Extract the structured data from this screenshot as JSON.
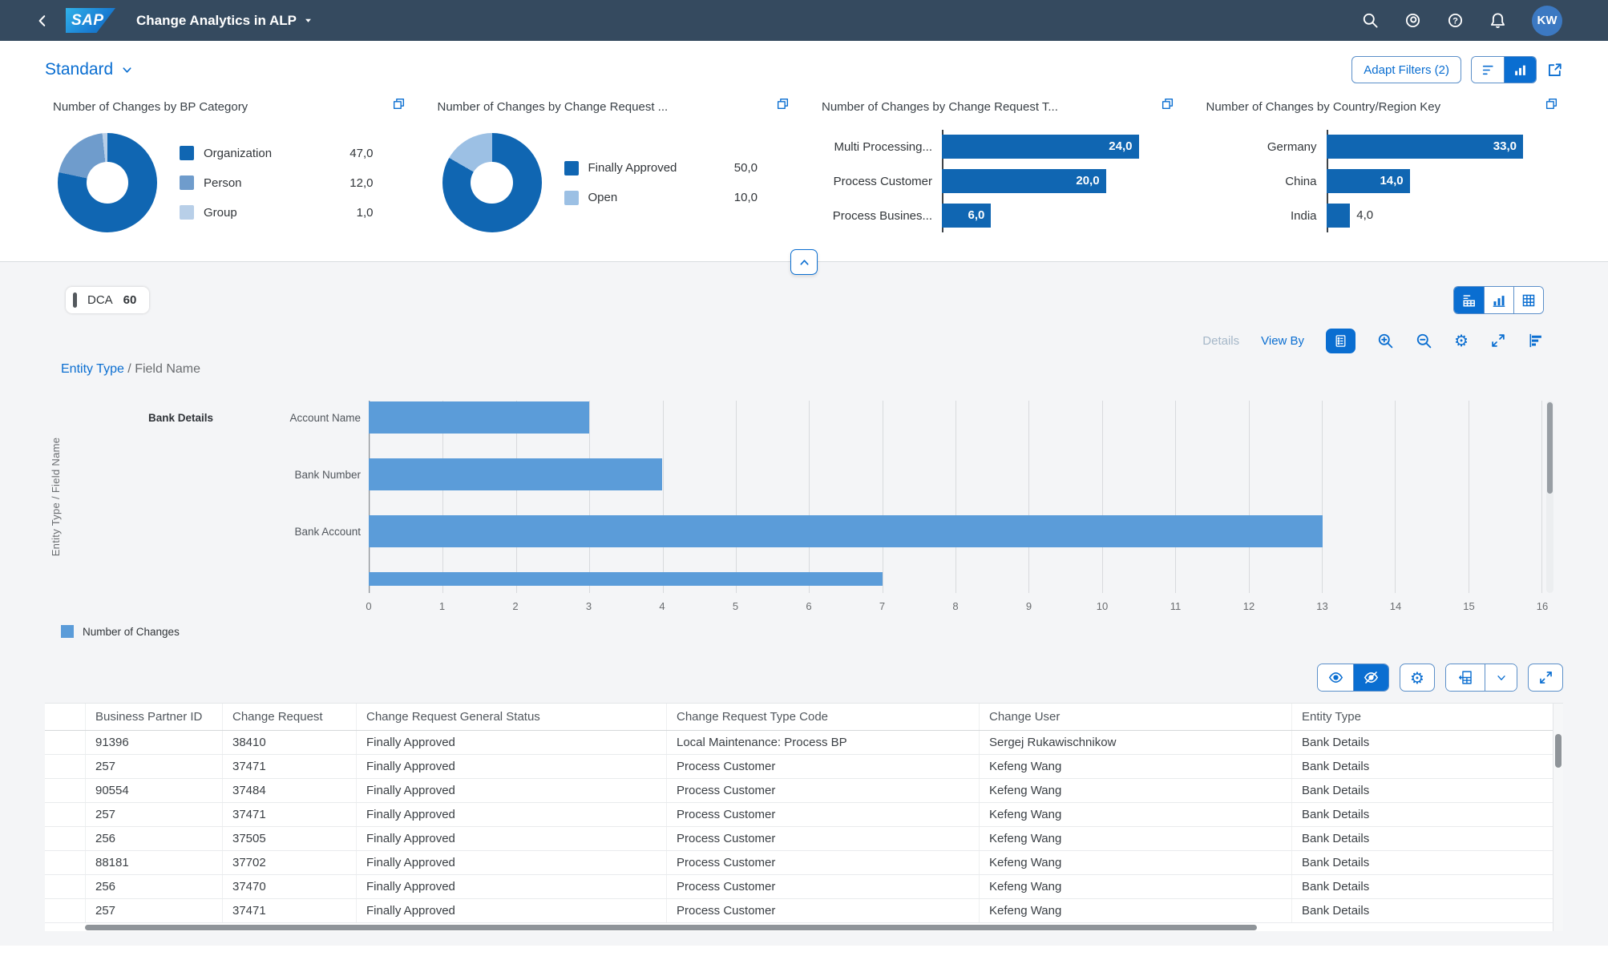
{
  "shell": {
    "logo": "SAP",
    "title": "Change Analytics in ALP",
    "avatar": "KW"
  },
  "filter_bar": {
    "variant": "Standard",
    "adapt_filters": "Adapt Filters (2)"
  },
  "cards": [
    {
      "title": "Number of Changes by BP Category",
      "segments": [
        {
          "label": "Organization",
          "display": "47,0",
          "value": 47,
          "color": "#1066b2"
        },
        {
          "label": "Person",
          "display": "12,0",
          "value": 12,
          "color": "#6f9ccc"
        },
        {
          "label": "Group",
          "display": "1,0",
          "value": 1,
          "color": "#b8cfe8"
        }
      ]
    },
    {
      "title": "Number of Changes by Change Request ...",
      "segments": [
        {
          "label": "Finally Approved",
          "display": "50,0",
          "value": 50,
          "color": "#1066b2"
        },
        {
          "label": "Open",
          "display": "10,0",
          "value": 10,
          "color": "#9cc0e4"
        }
      ]
    },
    {
      "title": "Number of Changes by Change Request T...",
      "max": 24,
      "bars": [
        {
          "label": "Multi Processing...",
          "display": "24,0",
          "value": 24
        },
        {
          "label": "Process Customer",
          "display": "20,0",
          "value": 20
        },
        {
          "label": "Process Busines...",
          "display": "6,0",
          "value": 6
        }
      ]
    },
    {
      "title": "Number of Changes by Country/Region Key",
      "max": 33,
      "bars": [
        {
          "label": "Germany",
          "display": "33,0",
          "value": 33
        },
        {
          "label": "China",
          "display": "14,0",
          "value": 14
        },
        {
          "label": "India",
          "display": "4,0",
          "value": 4
        }
      ]
    }
  ],
  "content": {
    "kpi_tag": {
      "label": "DCA",
      "value": "60"
    },
    "toolbar": {
      "details": "Details",
      "view_by": "View By"
    },
    "breadcrumb": {
      "link": "Entity Type",
      "separator": " / ",
      "current": "Field Name"
    },
    "legend": "Number of Changes"
  },
  "chart_data": {
    "type": "bar",
    "orientation": "horizontal",
    "y_axis_title": "Entity Type / Field Name",
    "group_label": "Bank Details",
    "categories": [
      "Account Name",
      "Bank Number",
      "Bank Account"
    ],
    "values": [
      3,
      4,
      13
    ],
    "partial_next_value": 7,
    "xlim": [
      0,
      16
    ],
    "x_ticks": [
      "0",
      "1",
      "2",
      "3",
      "4",
      "5",
      "6",
      "7",
      "8",
      "9",
      "10",
      "11",
      "12",
      "13",
      "14",
      "15",
      "16"
    ],
    "series": "Number of Changes",
    "bar_color": "#5b9cd9",
    "grid": true
  },
  "table": {
    "columns": [
      "Business Partner ID",
      "Change Request",
      "Change Request General Status",
      "Change Request Type Code",
      "Change User",
      "Entity Type"
    ],
    "rows": [
      [
        "91396",
        "38410",
        "Finally Approved",
        "Local Maintenance: Process BP",
        "Sergej Rukawischnikow",
        "Bank Details"
      ],
      [
        "257",
        "37471",
        "Finally Approved",
        "Process Customer",
        "Kefeng Wang",
        "Bank Details"
      ],
      [
        "90554",
        "37484",
        "Finally Approved",
        "Process Customer",
        "Kefeng Wang",
        "Bank Details"
      ],
      [
        "257",
        "37471",
        "Finally Approved",
        "Process Customer",
        "Kefeng Wang",
        "Bank Details"
      ],
      [
        "256",
        "37505",
        "Finally Approved",
        "Process Customer",
        "Kefeng Wang",
        "Bank Details"
      ],
      [
        "88181",
        "37702",
        "Finally Approved",
        "Process Customer",
        "Kefeng Wang",
        "Bank Details"
      ],
      [
        "256",
        "37470",
        "Finally Approved",
        "Process Customer",
        "Kefeng Wang",
        "Bank Details"
      ],
      [
        "257",
        "37471",
        "Finally Approved",
        "Process Customer",
        "Kefeng Wang",
        "Bank Details"
      ]
    ]
  }
}
